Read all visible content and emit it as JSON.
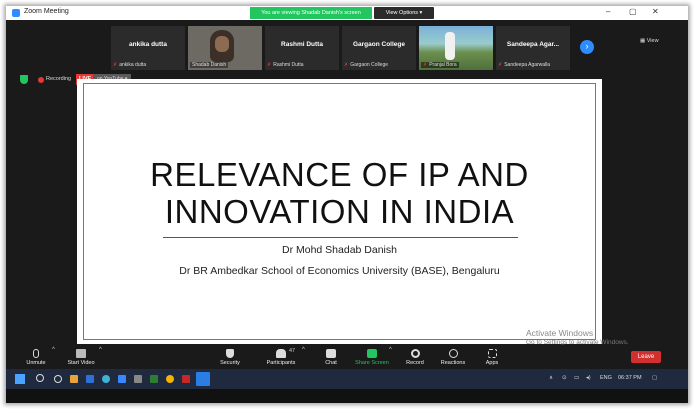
{
  "window": {
    "title": "Zoom Meeting",
    "viewing_banner": "You are viewing Shadab Danish's screen",
    "view_options": "View Options ▾"
  },
  "participants": [
    {
      "display": "ankika dutta",
      "label": "ankika dutta",
      "muted": true
    },
    {
      "display": "",
      "label": "Shadab Danish",
      "muted": false,
      "video": true
    },
    {
      "display": "Rashmi Dutta",
      "label": "Rashmi Dutta",
      "muted": true
    },
    {
      "display": "Gargaon College",
      "label": "Gargaon College",
      "muted": true
    },
    {
      "display": "",
      "label": "Pranjal Bora",
      "muted": true,
      "video": true
    },
    {
      "display": "Sandeepa Agar...",
      "label": "Sandeepa Agarwalla",
      "muted": true
    }
  ],
  "view_button": "View",
  "recording": {
    "label": "Recording",
    "live": "LIVE",
    "live_target": "on YouTube ▾"
  },
  "slide": {
    "title_line1": "RELEVANCE OF IP AND",
    "title_line2": "INNOVATION IN INDIA",
    "author": "Dr Mohd Shadab Danish",
    "affiliation": "Dr BR Ambedkar School of Economics University (BASE), Bengaluru"
  },
  "watermark": {
    "line1": "Activate Windows",
    "line2": "Go to Settings to activate Windows."
  },
  "toolbar": {
    "unmute": "Unmute",
    "start_video": "Start Video",
    "security": "Security",
    "participants": "Participants",
    "participants_count": "47",
    "chat": "Chat",
    "share_screen": "Share Screen",
    "record": "Record",
    "reactions": "Reactions",
    "apps": "Apps",
    "leave": "Leave"
  },
  "taskbar": {
    "language": "ENG",
    "time": "06:37 PM"
  },
  "colors": {
    "zoom_blue": "#2d8cff",
    "share_green": "#22c55e",
    "leave_red": "#d32f2f",
    "live_red": "#e53935"
  }
}
